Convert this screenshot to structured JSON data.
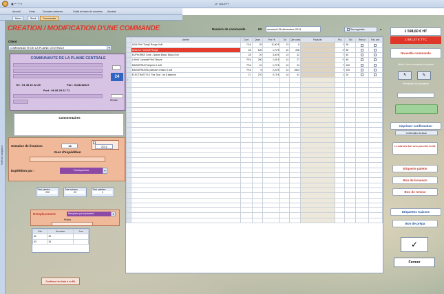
{
  "window": {
    "title": "LF VALEPY"
  },
  "tabs": [
    "Accueil",
    "Créer",
    "Données externes",
    "Outils de base de données",
    "Acrobat"
  ],
  "doc_tabs": [
    "Menu",
    "Stock",
    "Commandes"
  ],
  "nav_pane": {
    "label": "Volet de navigation"
  },
  "header": {
    "title": "CREATION / MODIFICATION D'UNE COMMANDE",
    "order_label": "Numéro de commande",
    "order_number": "63",
    "date": "vendredi 26 décembre 2011",
    "status": "Sauvegardée"
  },
  "client": {
    "label": "Client",
    "value": "COMMUNAUTE DE LA PLAINE CENTRALE",
    "card_title": "COMMUNAUTE DE LA PLAINE CENTRALE",
    "code": "24",
    "tel": "Tel : 01 45 10 22 25",
    "fax": "Fax : 0143102227",
    "port": "Port : 06 86 25 61 71",
    "remise_label": "Remise"
  },
  "comments": {
    "label": "Commentaires"
  },
  "delivery": {
    "week_label": "Semaine de livraison",
    "week": "18",
    "year": "2012",
    "day_label": "Jour d'expédition",
    "shipping_label": "Expédition par :",
    "shipping": "Transporteur"
  },
  "totals": {
    "labels": [
      "Total plantes",
      "Total caisses",
      "Total palettes"
    ],
    "values": [
      "200",
      "20",
      "1"
    ]
  },
  "replacement": {
    "label": "Remplacement",
    "value": "Remplacé par équivalent",
    "prices_label": "Prises"
  },
  "mini_table": {
    "headers": [
      "Cde",
      "Semaine",
      "Jour"
    ],
    "rows": [
      [
        "62",
        "18",
        ""
      ],
      [
        "63",
        "18",
        ""
      ]
    ],
    "row_label": "Nouv"
  },
  "bottom_button": "Confirmer les frais à ce Mt.",
  "table": {
    "headers": [
      "Variété",
      "Cont",
      "Quan",
      "Prix Ht",
      "Tot",
      "Qte caisses",
      "Pays/tail",
      "Pla",
      "Tail",
      "Retour",
      "Pac prix"
    ],
    "rows": [
      [
        "AZALPHA 'Tokaji' Rouge Vulli",
        "C16",
        "20",
        "11,60 €",
        "13",
        "6",
        "",
        "1",
        "36",
        "",
        ""
      ],
      [
        "AZALEA 'Turnbull' Rouge",
        "C8",
        "100",
        "1,70 €",
        "10",
        "248",
        "",
        "0",
        "50",
        "",
        ""
      ],
      [
        "EUPHORBE 'Lime - Nature Blanc' Blanc 8 ml",
        "C8",
        "20",
        "3,40 €",
        "13",
        "32",
        "",
        "7",
        "40",
        "",
        ""
      ],
      [
        "LIAMA 'Lavande Pink' Mauve",
        "P16",
        "200",
        "1,51 €",
        "14",
        "27",
        "",
        "0",
        "48",
        "",
        ""
      ],
      [
        "MAGNIFRIA Pompeux 1 soft",
        "P16",
        "10",
        "1,70 €",
        "13",
        "24",
        "",
        "7",
        "100",
        "",
        ""
      ],
      [
        "MAGNIFRIA Bic pâteuse 4 blanc 8 soft",
        "P16",
        "6",
        "2,20 €",
        "14",
        "1604",
        "",
        "7",
        "100",
        "",
        ""
      ],
      [
        "ELECTRASTYLE 'Tea Tour' 1 et 8 blanche",
        "C7",
        "270",
        "0,71 €",
        "14",
        "41",
        "",
        "1",
        "20",
        "",
        ""
      ]
    ]
  },
  "right": {
    "total_ht": "1 598,60 € HT",
    "total_ttc": "1 891,47 € TTC",
    "new_order": "Nouvelle commande",
    "sel_label": "Sélect. d'une commande à imprimer",
    "autre_label": "Réinitialiser la commande",
    "confirm_print": "Imprimer confirmation",
    "confirm_sub": "Confirmation livraison",
    "coef_label": "Le total dès Suiv avec parcelles du Mt.",
    "etiq_pal": "Etiquette palette",
    "bon_liv": "Bon de livraison",
    "bon_remise": "Bon de remise",
    "etiq_cais": "Etiquettes Caisses",
    "bon_prepa": "Bon de prépa",
    "ok": "✓",
    "fermer": "Fermer"
  },
  "colors": {
    "title_red": "#e0362a",
    "header_blue": "#1f4e9b",
    "selected_row": "#e53a2c"
  }
}
